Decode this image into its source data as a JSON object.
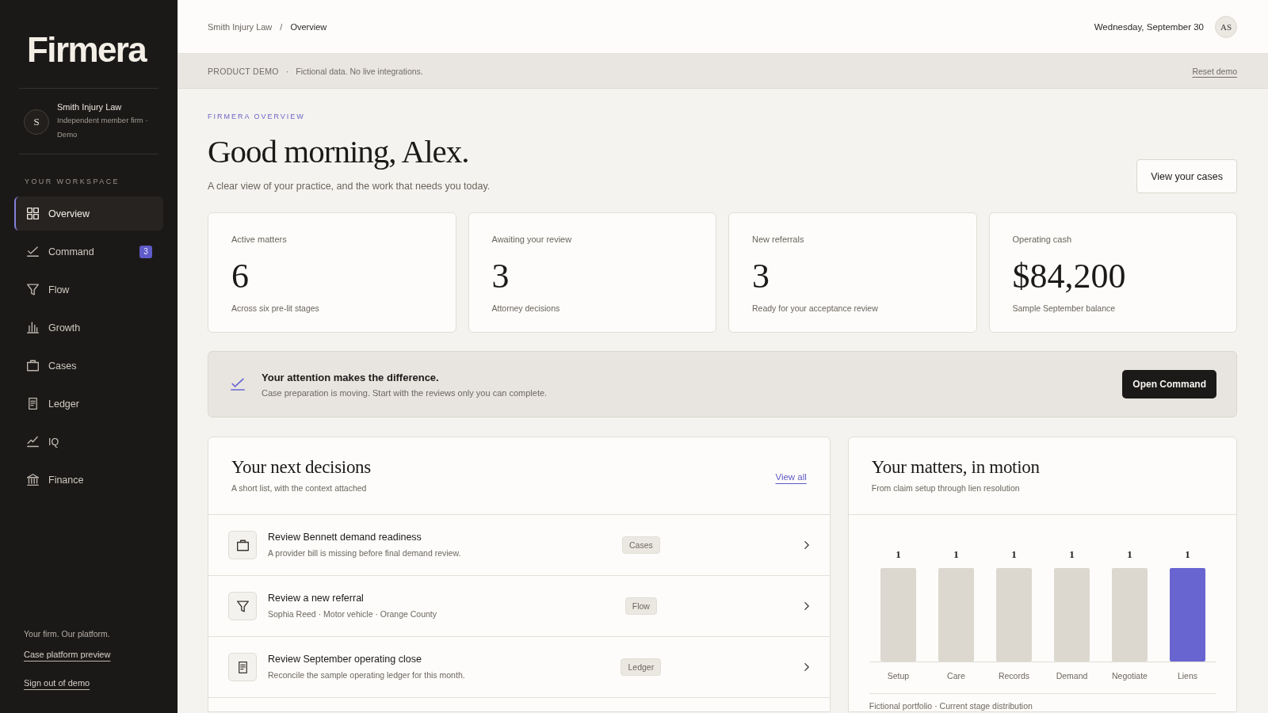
{
  "sidebar": {
    "logo": "Firmera",
    "firm": {
      "avatar": "S",
      "name": "Smith Injury Law",
      "detail": "Independent member firm · Demo"
    },
    "section_label": "YOUR WORKSPACE",
    "items": [
      {
        "label": "Overview",
        "selected": true
      },
      {
        "label": "Command",
        "selected": false,
        "badge": "3"
      },
      {
        "label": "Flow",
        "selected": false
      },
      {
        "label": "Growth",
        "selected": false
      },
      {
        "label": "Cases",
        "selected": false
      },
      {
        "label": "Ledger",
        "selected": false
      },
      {
        "label": "IQ",
        "selected": false
      },
      {
        "label": "Finance",
        "selected": false
      }
    ],
    "footer": {
      "tagline": "Your firm. Our platform.",
      "links": [
        "Case platform preview",
        "Sign out of demo"
      ]
    }
  },
  "header": {
    "breadcrumb": {
      "items": [
        "Smith Injury Law",
        "Overview"
      ],
      "separator": "/"
    },
    "date": "Wednesday, September 30",
    "avatar": "AS"
  },
  "demo_banner": {
    "label": "PRODUCT DEMO",
    "separator": "·",
    "note": "Fictional data. No live integrations.",
    "action": "Reset demo"
  },
  "overview": {
    "eyebrow": "FIRMERA OVERVIEW",
    "title": "Good morning, Alex.",
    "subtitle": "A clear view of your practice, and the work that needs you today.",
    "action": "View your cases"
  },
  "stats": [
    {
      "label": "Active matters",
      "value": "6",
      "note": "Across six pre-lit stages"
    },
    {
      "label": "Awaiting your review",
      "value": "3",
      "note": "Attorney decisions"
    },
    {
      "label": "New referrals",
      "value": "3",
      "note": "Ready for your acceptance review"
    },
    {
      "label": "Operating cash",
      "value": "$84,200",
      "note": "Sample September balance"
    }
  ],
  "attention": {
    "title": "Your attention makes the difference.",
    "text": "Case preparation is moving. Start with the reviews only you can complete.",
    "action": "Open Command"
  },
  "decisions": {
    "title": "Your next decisions",
    "subtitle": "A short list, with the context attached",
    "link": "View all",
    "rows": [
      {
        "title": "Review Bennett demand readiness",
        "detail": "A provider bill is missing before final demand review.",
        "tag": "Cases"
      },
      {
        "title": "Review a new referral",
        "detail": "Sophia Reed · Motor vehicle · Orange County",
        "tag": "Flow"
      },
      {
        "title": "Review September operating close",
        "detail": "Reconcile the sample operating ledger for this month.",
        "tag": "Ledger"
      }
    ]
  },
  "matters": {
    "title": "Your matters, in motion",
    "subtitle": "From claim setup through lien resolution",
    "chart_data": {
      "type": "bar",
      "categories": [
        "Setup",
        "Care",
        "Records",
        "Demand",
        "Negotiate",
        "Liens"
      ],
      "values": [
        1,
        1,
        1,
        1,
        1,
        1
      ],
      "data_labels": true
    },
    "bars": [
      {
        "color": "#dcd8cf"
      },
      {
        "color": "#dcd8cf"
      },
      {
        "color": "#dcd8cf"
      },
      {
        "color": "#dcd8cf"
      },
      {
        "color": "#dcd8cf"
      },
      {
        "color": "#6865d1"
      }
    ],
    "footnote": "Fictional portfolio · Current stage distribution"
  }
}
